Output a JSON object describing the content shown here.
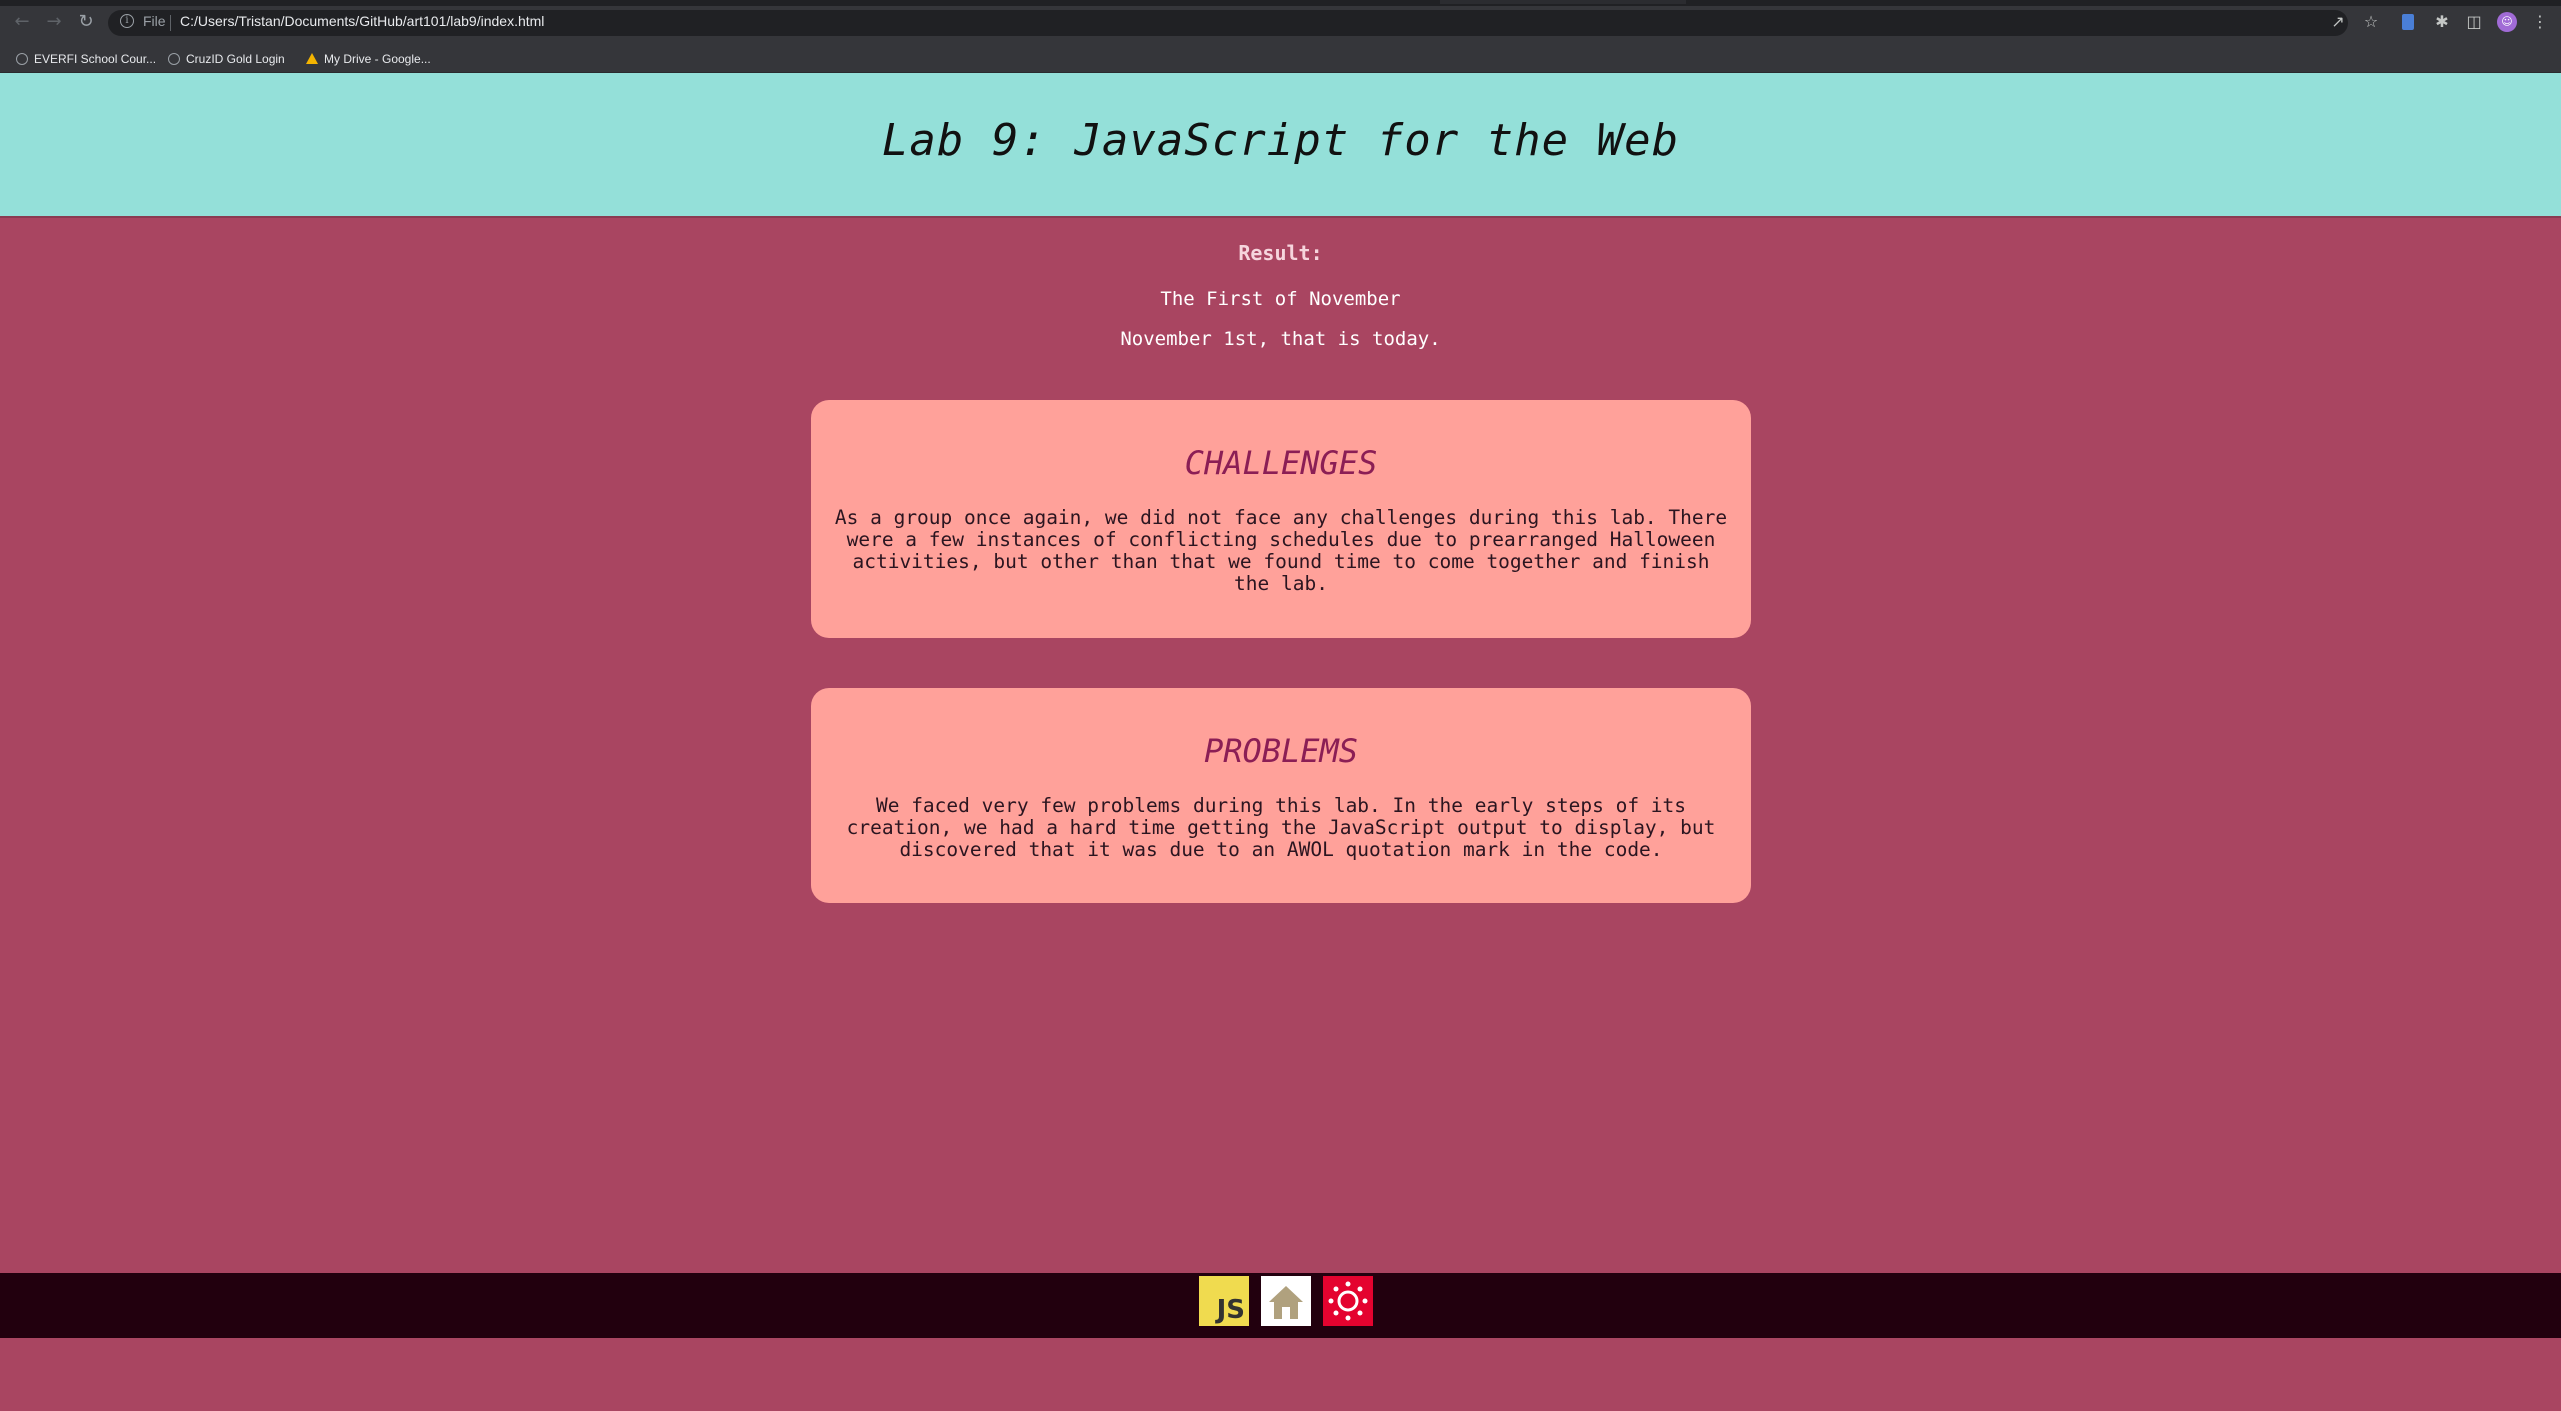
{
  "browser": {
    "address": {
      "scheme_label": "File",
      "url": "C:/Users/Tristan/Documents/GitHub/art101/lab9/index.html"
    },
    "bookmarks": [
      {
        "label": "EVERFI School Cour..."
      },
      {
        "label": "CruzID Gold Login"
      },
      {
        "label": "My Drive - Google..."
      }
    ]
  },
  "page": {
    "title": "Lab 9: JavaScript for the Web",
    "result": {
      "label": "Result:",
      "line1": "The First of November",
      "line2": "November 1st, that is today."
    },
    "cards": [
      {
        "title": "CHALLENGES",
        "body": "As a group once again, we did not face any challenges during this lab. There were a few instances of conflicting schedules due to prearranged Halloween activities, but other than that we found time to come together and finish the lab."
      },
      {
        "title": "PROBLEMS",
        "body": "We faced very few problems during this lab. In the early steps of its creation, we had a hard time getting the JavaScript output to display, but discovered that it was due to an AWOL quotation mark in the code."
      }
    ],
    "footer": {
      "links": [
        {
          "icon": "javascript-logo-icon",
          "text": "JS"
        },
        {
          "icon": "home-icon"
        },
        {
          "icon": "canvas-logo-icon"
        }
      ]
    }
  },
  "colors": {
    "header_bg": "#94e0d9",
    "page_bg": "#a94561",
    "card_bg": "#ffa19a",
    "card_title": "#8b1e55",
    "footer_bg": "#22000e"
  }
}
